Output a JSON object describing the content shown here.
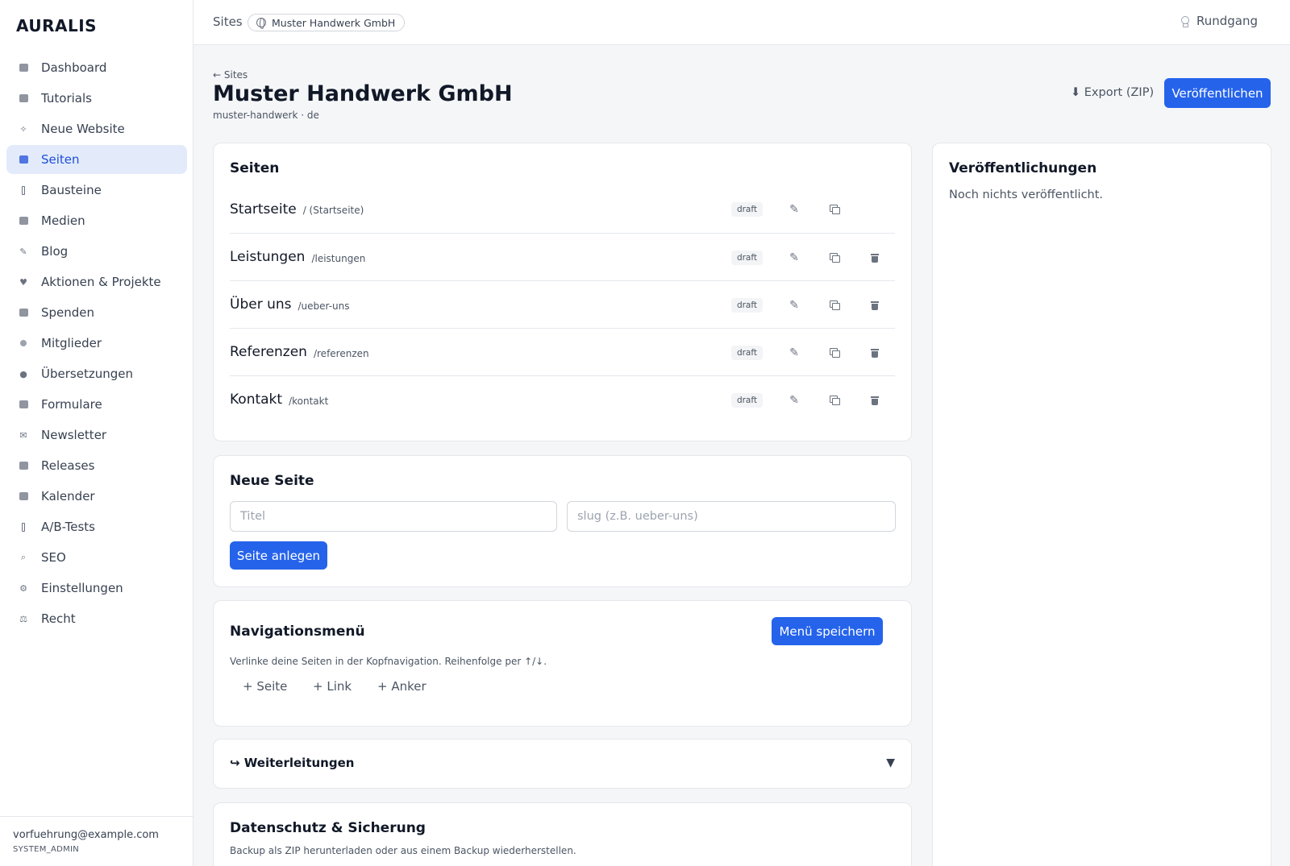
{
  "app": {
    "logo": "AURALIS"
  },
  "sidebar": {
    "items": [
      {
        "label": "Dashboard",
        "icon": "dashboard-icon",
        "glyph": "sq"
      },
      {
        "label": "Tutorials",
        "icon": "clapperboard-icon",
        "glyph": "sq"
      },
      {
        "label": "Neue Website",
        "icon": "sparkle-icon",
        "glyph": "✧"
      },
      {
        "label": "Seiten",
        "icon": "page-icon",
        "glyph": "sq",
        "active": true
      },
      {
        "label": "Bausteine",
        "icon": "block-icon",
        "glyph": "bar"
      },
      {
        "label": "Medien",
        "icon": "image-icon",
        "glyph": "sq"
      },
      {
        "label": "Blog",
        "icon": "pen-icon",
        "glyph": "✎"
      },
      {
        "label": "Aktionen & Projekte",
        "icon": "heart-icon",
        "glyph": "♥"
      },
      {
        "label": "Spenden",
        "icon": "card-icon",
        "glyph": "sq"
      },
      {
        "label": "Mitglieder",
        "icon": "people-icon",
        "glyph": "dot"
      },
      {
        "label": "Übersetzungen",
        "icon": "globe-icon",
        "glyph": "●"
      },
      {
        "label": "Formulare",
        "icon": "clipboard-icon",
        "glyph": "sq"
      },
      {
        "label": "Newsletter",
        "icon": "mail-icon",
        "glyph": "✉"
      },
      {
        "label": "Releases",
        "icon": "package-icon",
        "glyph": "sq"
      },
      {
        "label": "Kalender",
        "icon": "calendar-icon",
        "glyph": "sq"
      },
      {
        "label": "A/B-Tests",
        "icon": "test-icon",
        "glyph": "bar"
      },
      {
        "label": "SEO",
        "icon": "magnifier-icon",
        "glyph": "⌕"
      },
      {
        "label": "Einstellungen",
        "icon": "gear-icon",
        "glyph": "⚙"
      },
      {
        "label": "Recht",
        "icon": "scales-icon",
        "glyph": "⚖"
      }
    ],
    "user_email": "vorfuehrung@example.com",
    "user_role": "SYSTEM_ADMIN"
  },
  "topbar": {
    "crumb": "Sites",
    "site_name": "Muster Handwerk GmbH",
    "tour_label": "Rundgang"
  },
  "header": {
    "back_label": "← Sites",
    "title": "Muster Handwerk GmbH",
    "subtitle": "muster-handwerk · de",
    "export_label": "⬇ Export (ZIP)",
    "publish_label": "Veröffentlichen"
  },
  "pages": {
    "title": "Seiten",
    "rows": [
      {
        "title": "Startseite",
        "slug": "/ (Startseite)",
        "status": "draft",
        "deletable": false
      },
      {
        "title": "Leistungen",
        "slug": "/leistungen",
        "status": "draft",
        "deletable": true
      },
      {
        "title": "Über uns",
        "slug": "/ueber-uns",
        "status": "draft",
        "deletable": true
      },
      {
        "title": "Referenzen",
        "slug": "/referenzen",
        "status": "draft",
        "deletable": true
      },
      {
        "title": "Kontakt",
        "slug": "/kontakt",
        "status": "draft",
        "deletable": true
      }
    ]
  },
  "new_page": {
    "title": "Neue Seite",
    "title_placeholder": "Titel",
    "slug_placeholder": "slug (z.B. ueber-uns)",
    "create_label": "Seite anlegen"
  },
  "nav_menu": {
    "title": "Navigationsmenü",
    "save_label": "Menü speichern",
    "description": "Verlinke deine Seiten in der Kopfnavigation. Reihenfolge per ↑/↓.",
    "add_page": "+ Seite",
    "add_link": "+ Link",
    "add_anchor": "+ Anker"
  },
  "redirects": {
    "title": "↪ Weiterleitungen",
    "chevron": "▼"
  },
  "privacy": {
    "title": "Datenschutz & Sicherung",
    "description": "Backup als ZIP herunterladen oder aus einem Backup wiederherstellen."
  },
  "publications": {
    "title": "Veröffentlichungen",
    "empty": "Noch nichts veröffentlicht."
  },
  "colors": {
    "accent": "#2563eb",
    "active_bg": "#e3ebfb"
  }
}
